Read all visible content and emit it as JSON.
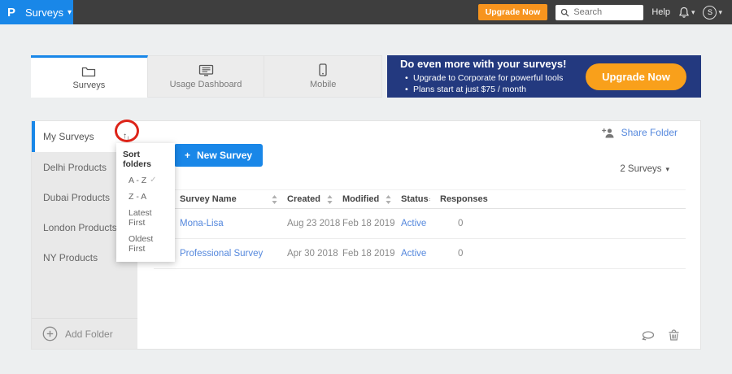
{
  "topbar": {
    "logo": "P",
    "app_menu": "Surveys",
    "upgrade_label": "Upgrade Now",
    "search_placeholder": "Search",
    "help_label": "Help",
    "avatar_initial": "S"
  },
  "tabs": [
    {
      "label": "Surveys",
      "active": true
    },
    {
      "label": "Usage Dashboard",
      "active": false
    },
    {
      "label": "Mobile",
      "active": false
    }
  ],
  "banner": {
    "title": "Do even more with your surveys!",
    "bullets": [
      "Upgrade to Corporate for powerful tools",
      "Plans start at just $75 / month"
    ],
    "cta": "Upgrade Now"
  },
  "sidebar": {
    "items": [
      {
        "label": "My Surveys",
        "active": true
      },
      {
        "label": "Delhi Products",
        "active": false
      },
      {
        "label": "Dubai Products",
        "active": false
      },
      {
        "label": "London Products",
        "active": false
      },
      {
        "label": "NY Products",
        "active": false
      }
    ],
    "add_folder": "Add Folder"
  },
  "sort_menu": {
    "title": "Sort folders",
    "options": [
      {
        "label": "A - Z",
        "checked": true
      },
      {
        "label": "Z - A",
        "checked": false
      },
      {
        "label": "Latest First",
        "checked": false
      },
      {
        "label": "Oldest First",
        "checked": false
      }
    ]
  },
  "main": {
    "new_survey": "New Survey",
    "share_folder": "Share Folder",
    "survey_count": "2 Surveys"
  },
  "table": {
    "headers": [
      "Survey Name",
      "Created",
      "Modified",
      "Status",
      "Responses"
    ],
    "rows": [
      {
        "name": "Mona-Lisa",
        "created": "Aug 23 2018",
        "modified": "Feb 18 2019",
        "status": "Active",
        "responses": "0"
      },
      {
        "name": "Professional Survey",
        "created": "Apr 30 2018",
        "modified": "Feb 18 2019",
        "status": "Active",
        "responses": "0"
      }
    ]
  },
  "icons": {
    "plus": "+",
    "caret_down": "▾",
    "check": "✓",
    "sort_up": "↑",
    "sort_down": "↓",
    "bullet": "•"
  },
  "colors": {
    "accent_blue": "#1987e8",
    "banner_navy": "#23397f",
    "orange": "#f7941e",
    "link_blue": "#5588dd",
    "annotation_red": "#dd2419",
    "topbar_gray": "#3e3e3e"
  }
}
